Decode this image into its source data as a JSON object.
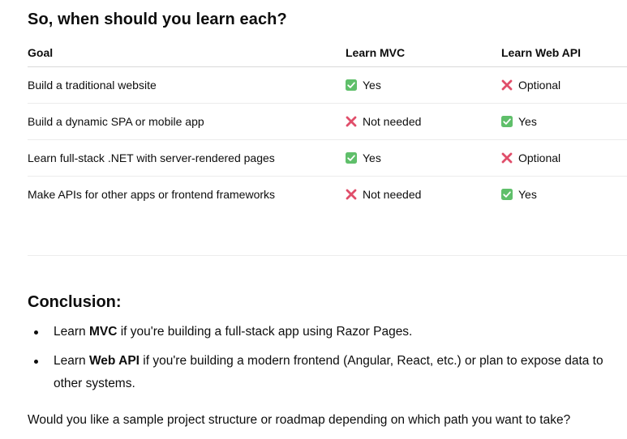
{
  "section_title": "So, when should you learn each?",
  "table": {
    "headers": [
      "Goal",
      "Learn MVC",
      "Learn Web API"
    ],
    "rows": [
      {
        "goal": "Build a traditional website",
        "mvc": {
          "icon": "check-icon",
          "text": "Yes"
        },
        "api": {
          "icon": "cross-icon",
          "text": "Optional"
        }
      },
      {
        "goal": "Build a dynamic SPA or mobile app",
        "mvc": {
          "icon": "cross-icon",
          "text": "Not needed"
        },
        "api": {
          "icon": "check-icon",
          "text": "Yes"
        }
      },
      {
        "goal": "Learn full-stack .NET with server-rendered pages",
        "mvc": {
          "icon": "check-icon",
          "text": "Yes"
        },
        "api": {
          "icon": "cross-icon",
          "text": "Optional"
        }
      },
      {
        "goal": "Make APIs for other apps or frontend frameworks",
        "mvc": {
          "icon": "cross-icon",
          "text": "Not needed"
        },
        "api": {
          "icon": "check-icon",
          "text": "Yes"
        }
      }
    ]
  },
  "conclusion": {
    "title": "Conclusion:",
    "bullets": [
      {
        "prefix": "Learn ",
        "bold": "MVC",
        "suffix": " if you're building a full-stack app using Razor Pages."
      },
      {
        "prefix": "Learn ",
        "bold": "Web API",
        "suffix": " if you're building a modern frontend (Angular, React, etc.) or plan to expose data to other systems."
      }
    ]
  },
  "followup": "Would you like a sample project structure or roadmap depending on which path you want to take?",
  "colors": {
    "check_bg": "#5fbf6a",
    "cross": "#e04e6a",
    "text": "#0d0d0d"
  }
}
